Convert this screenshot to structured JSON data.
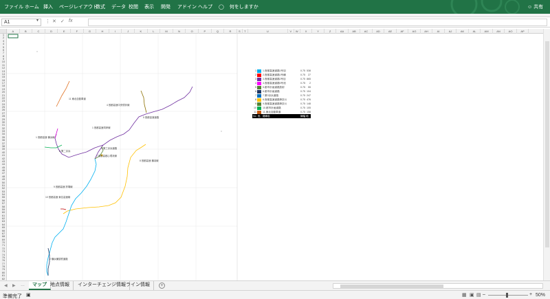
{
  "ribbon": {
    "tabs": [
      "ファイル",
      "ホーム",
      "挿入",
      "ページレイアウト",
      "数式",
      "データ",
      "校閲",
      "表示",
      "開発",
      "アドイン",
      "ヘルプ"
    ],
    "tell_me": "何をしますか",
    "share": "共有",
    "accent": "#217346"
  },
  "formula_bar": {
    "name_box": "A1",
    "cancel_icon": "✕",
    "enter_icon": "✓",
    "fx_label": "fx",
    "formula": ""
  },
  "grid": {
    "columns": [
      "A",
      "B",
      "C",
      "D",
      "E",
      "F",
      "G",
      "H",
      "I",
      "J",
      "K",
      "L",
      "M",
      "N",
      "O",
      "P",
      "Q",
      "R",
      "S",
      "T",
      "U",
      "V",
      "W",
      "X",
      "Y",
      "Z",
      "AA",
      "AB",
      "AC",
      "AD",
      "AE",
      "AF",
      "AG",
      "AH",
      "AI",
      "AJ",
      "AK",
      "AL",
      "AM",
      "AN",
      "AO",
      "AP"
    ],
    "row_count": 82
  },
  "map": {
    "labels": [
      "11 東北自動車道",
      "4 首都高速中央環状線",
      "5 首都高速道路",
      "1 首都高速湾岸線",
      "1 首都高速 横浜線",
      "3 第三京浜道路",
      "6 第二京浜",
      "7 首都高都心環状線",
      "8 首都高速 横羽線",
      "9 首都高速 狩場線",
      "10 首都高速 東名高速線",
      "2 横浜横須賀道路",
      "12 国道 1号"
    ],
    "line_colors": [
      "#00b0f0",
      "#c00000",
      "#7030a0",
      "#d000d0",
      "#548235",
      "#9c5700",
      "#4472c4",
      "#ffc000",
      "#8b6f00",
      "#00b050",
      "#e07020"
    ]
  },
  "legend": {
    "headers": [
      "No",
      "色",
      "路線名",
      "線幅",
      "地点数"
    ],
    "rows": [
      {
        "no": "1",
        "color": "#00b0f0",
        "name": "1.首都高速道路1号羽",
        "width": "0.75",
        "points": "538"
      },
      {
        "no": "2",
        "color": "#ff0000",
        "name": "2.首都高速道路1号横",
        "width": "0.75",
        "points": "27"
      },
      {
        "no": "3",
        "color": "#7030a0",
        "name": "3.首都高速道路2号目",
        "width": "0.75",
        "points": "865"
      },
      {
        "no": "4",
        "color": "#ff00ff",
        "name": "4.首都高速道路5号池",
        "width": "0.75",
        "points": "2"
      },
      {
        "no": "5",
        "color": "#548235",
        "name": "5.都市計画道路放射",
        "width": "0.75",
        "points": "55"
      },
      {
        "no": "6",
        "color": "#1f3864",
        "name": "6.都市計画道路",
        "width": "0.75",
        "points": "104"
      },
      {
        "no": "7",
        "color": "#0070c0",
        "name": "7.第3京浜道路",
        "width": "0.75",
        "points": "247"
      },
      {
        "no": "8",
        "color": "#ffc000",
        "name": "8.首都高速道路神奈川",
        "width": "0.75",
        "points": "476"
      },
      {
        "no": "9",
        "color": "#548235",
        "name": "9.首都高速道路神奈川",
        "width": "0.75",
        "points": "148"
      },
      {
        "no": "10",
        "color": "#00b050",
        "name": "10.都市計画道路",
        "width": "0.75",
        "points": "105"
      },
      {
        "no": "11",
        "color": "#c55a11",
        "name": "11.東北自動車道",
        "width": "0.75",
        "points": "158"
      }
    ]
  },
  "sheets": {
    "tabs": [
      "マップ",
      "地点情報",
      "インターチェンジ情報",
      "ライン情報"
    ],
    "active": 0,
    "add_label": "+"
  },
  "status": {
    "ready": "準備完了",
    "zoom": "50%",
    "zoom_level": 0.5
  }
}
